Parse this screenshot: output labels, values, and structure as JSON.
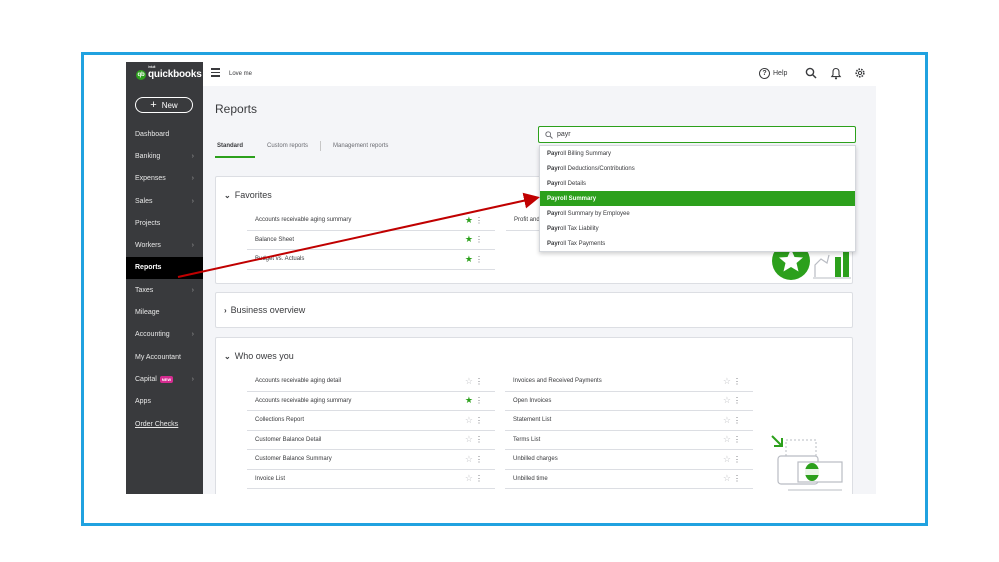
{
  "app": {
    "brand_small": "intuit",
    "brand": "quickbooks",
    "company": "Love me"
  },
  "sidebar": {
    "new_label": "New",
    "items": [
      {
        "label": "Dashboard",
        "chev": ""
      },
      {
        "label": "Banking",
        "chev": "›"
      },
      {
        "label": "Expenses",
        "chev": "›"
      },
      {
        "label": "Sales",
        "chev": "›"
      },
      {
        "label": "Projects",
        "chev": ""
      },
      {
        "label": "Workers",
        "chev": "›"
      },
      {
        "label": "Reports",
        "chev": ""
      },
      {
        "label": "Taxes",
        "chev": "›"
      },
      {
        "label": "Mileage",
        "chev": ""
      },
      {
        "label": "Accounting",
        "chev": "›"
      },
      {
        "label": "My Accountant",
        "chev": ""
      },
      {
        "label": "Capital",
        "chev": "›",
        "badge": "NEW"
      },
      {
        "label": "Apps",
        "chev": ""
      },
      {
        "label": "Order Checks",
        "chev": ""
      }
    ]
  },
  "topbar": {
    "help_label": "Help"
  },
  "page": {
    "title": "Reports"
  },
  "tabs": [
    "Standard",
    "Custom reports",
    "Management reports"
  ],
  "search": {
    "value": "payr",
    "placeholder": ""
  },
  "dropdown": [
    {
      "match": "Payr",
      "rest": "oll Billing Summary"
    },
    {
      "match": "Payr",
      "rest": "oll Deductions/Contributions"
    },
    {
      "match": "Payr",
      "rest": "oll Details"
    },
    {
      "match": "Payr",
      "rest": "oll Summary"
    },
    {
      "match": "Payr",
      "rest": "oll Summary by Employee"
    },
    {
      "match": "Payr",
      "rest": "oll Tax Liability"
    },
    {
      "match": "Payr",
      "rest": "oll Tax Payments"
    }
  ],
  "favorites": {
    "title": "Favorites",
    "left": [
      "Accounts receivable aging summary",
      "Balance Sheet",
      "Budget vs. Actuals"
    ],
    "right": [
      "Profit and"
    ]
  },
  "business_overview": {
    "title": "Business overview"
  },
  "who_owes": {
    "title": "Who owes you",
    "left": [
      {
        "label": "Accounts receivable aging detail",
        "fav": false
      },
      {
        "label": "Accounts receivable aging summary",
        "fav": true
      },
      {
        "label": "Collections Report",
        "fav": false
      },
      {
        "label": "Customer Balance Detail",
        "fav": false
      },
      {
        "label": "Customer Balance Summary",
        "fav": false
      },
      {
        "label": "Invoice List",
        "fav": false
      }
    ],
    "right": [
      {
        "label": "Invoices and Received Payments",
        "fav": false
      },
      {
        "label": "Open Invoices",
        "fav": false
      },
      {
        "label": "Statement List",
        "fav": false
      },
      {
        "label": "Terms List",
        "fav": false
      },
      {
        "label": "Unbilled charges",
        "fav": false
      },
      {
        "label": "Unbilled time",
        "fav": false
      }
    ]
  },
  "colors": {
    "accent": "#2ca01c",
    "sidebar": "#393a3d",
    "frame": "#20a2e0",
    "annotation": "#c00000"
  }
}
